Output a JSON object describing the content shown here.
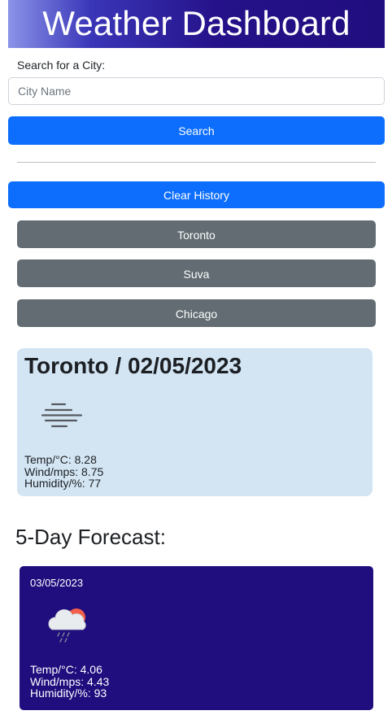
{
  "header": {
    "title": "Weather Dashboard"
  },
  "search": {
    "label": "Search for a City:",
    "placeholder": "City Name",
    "value": "",
    "button_label": "Search"
  },
  "history": {
    "clear_label": "Clear History",
    "cities": [
      "Toronto",
      "Suva",
      "Chicago"
    ]
  },
  "current": {
    "title": "Toronto / 02/05/2023",
    "icon": "fog-icon",
    "temp": "Temp/°C: 8.28",
    "wind": "Wind/mps: 8.75",
    "humidity": "Humidity/%: 77"
  },
  "forecast": {
    "heading": "5-Day Forecast:",
    "days": [
      {
        "date": "03/05/2023",
        "icon": "rain-cloud-sun-icon",
        "temp": "Temp/°C: 4.06",
        "wind": "Wind/mps: 4.43",
        "humidity": "Humidity/%: 93"
      }
    ]
  },
  "colors": {
    "primary": "#0d6efd",
    "secondary": "#626c72",
    "current_card": "#d3e5f3",
    "forecast_card": "#200d7e",
    "header_dark": "#200d7e"
  }
}
